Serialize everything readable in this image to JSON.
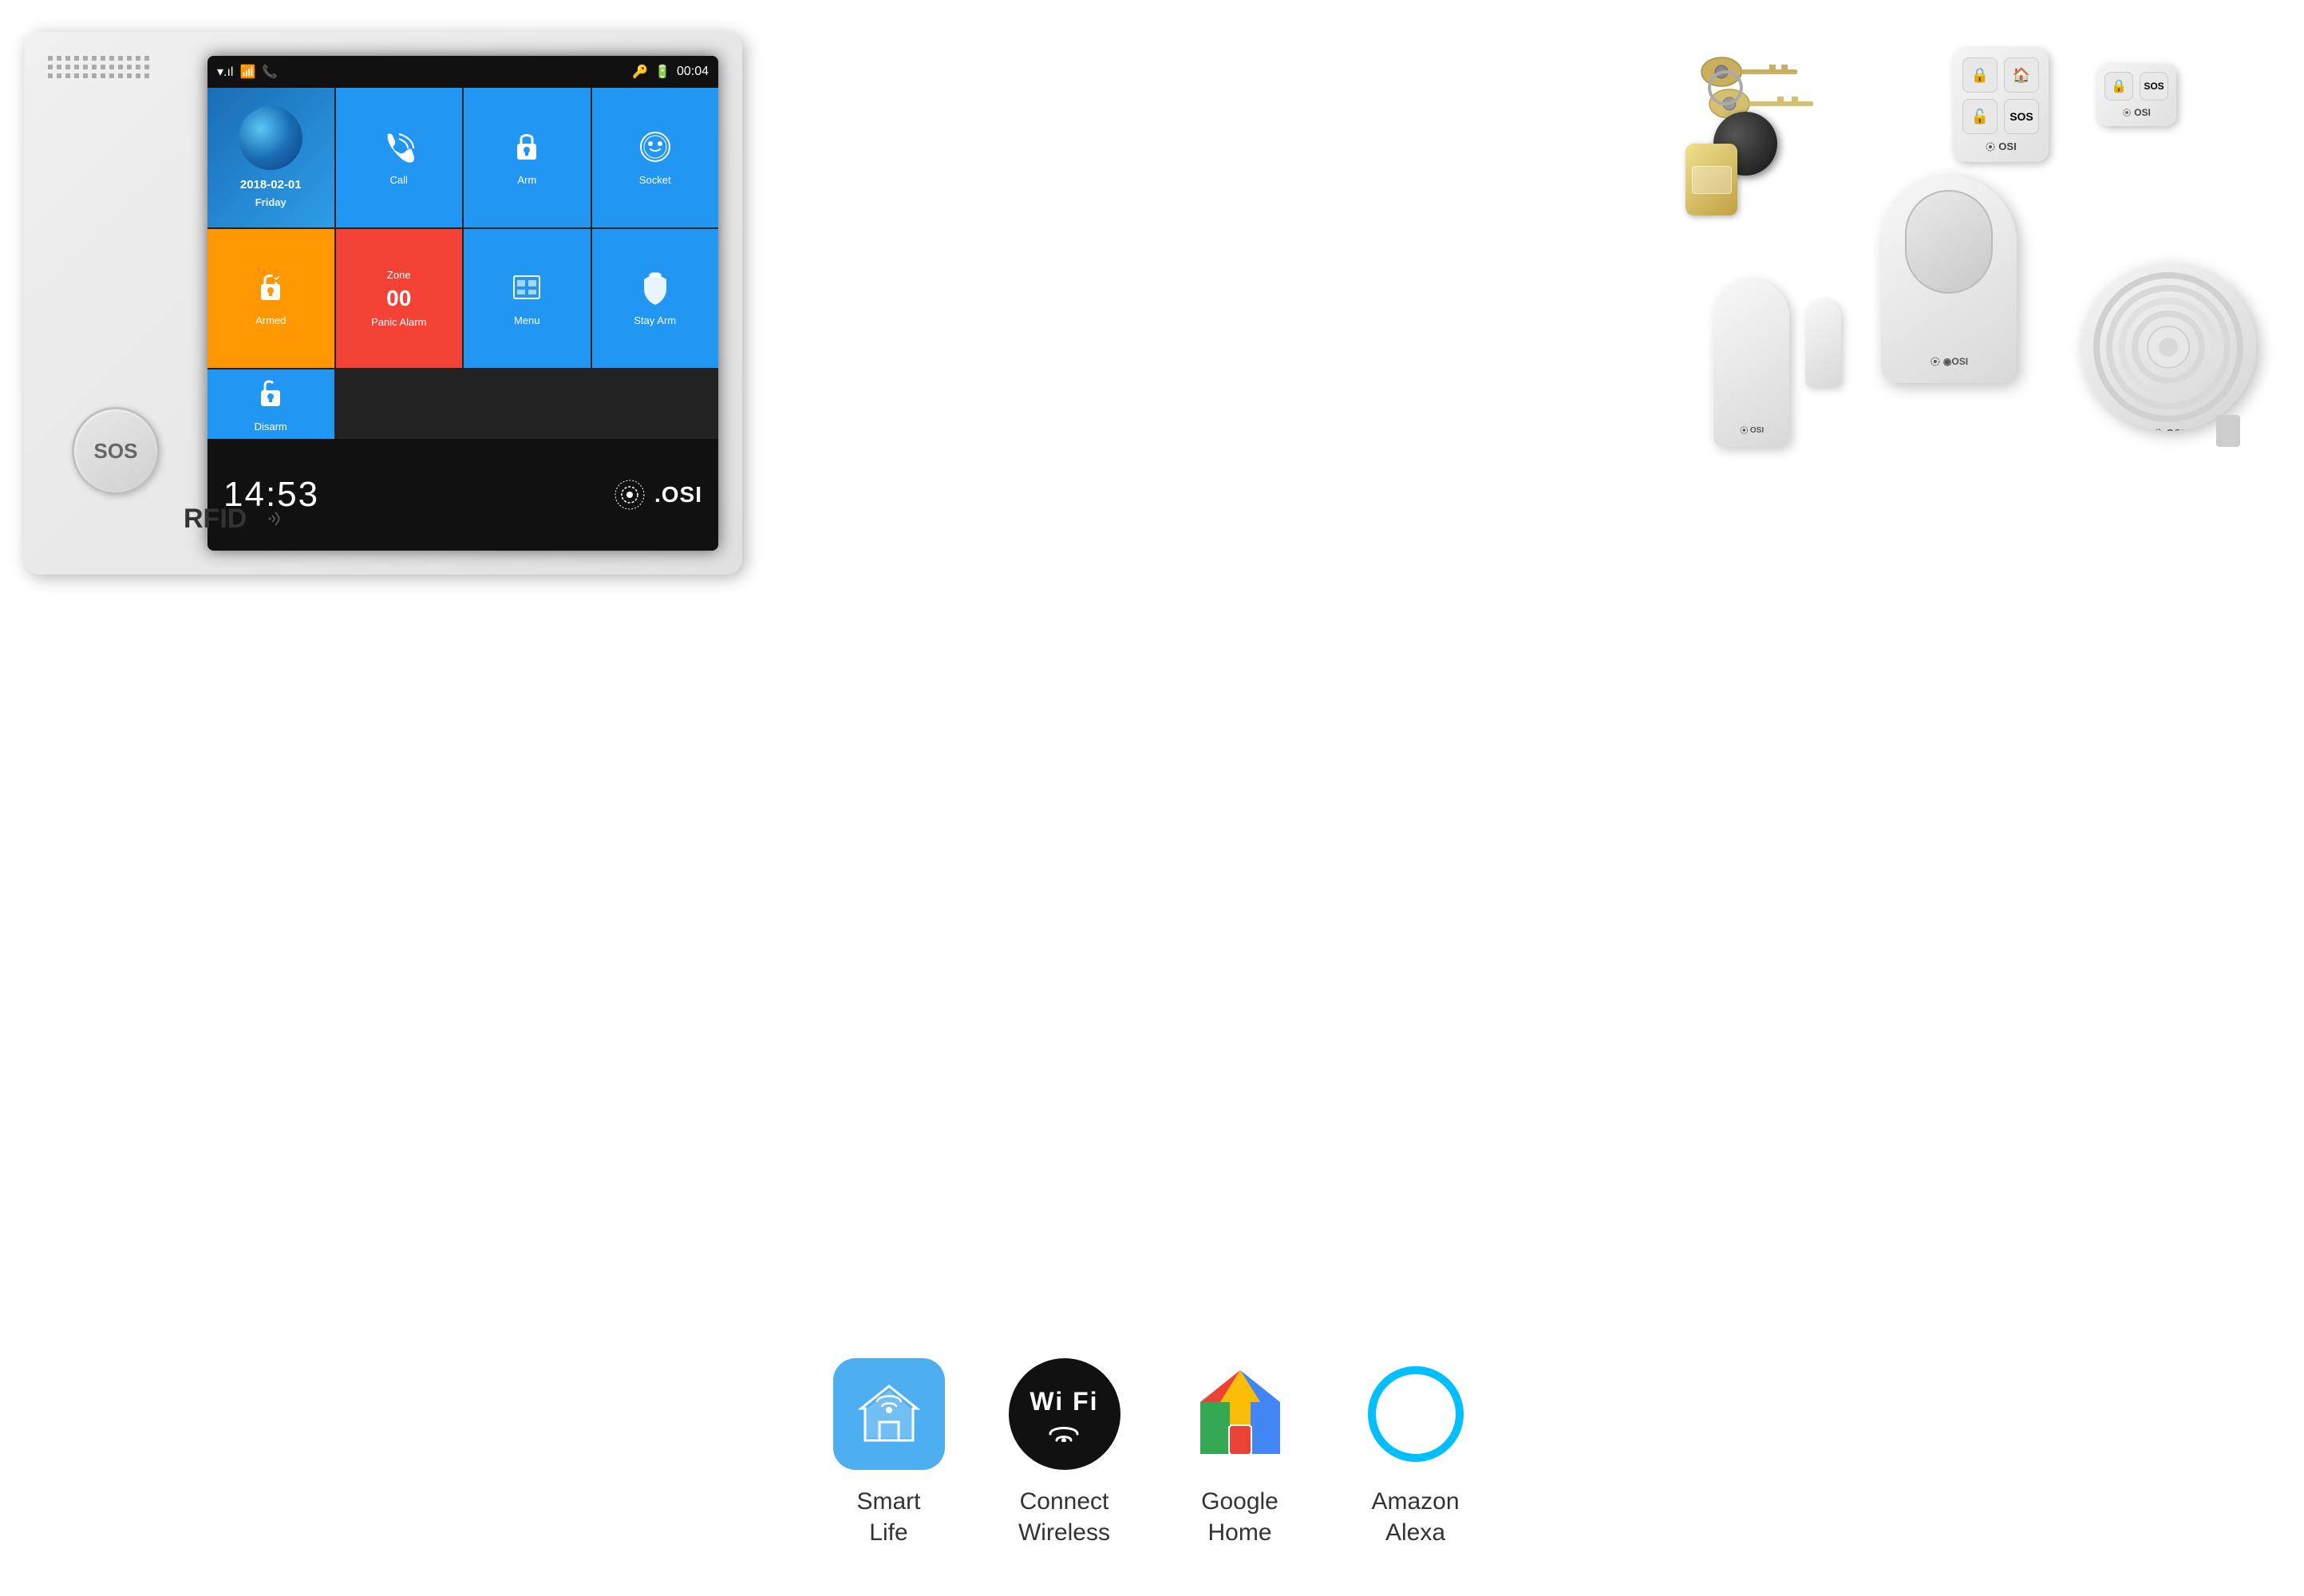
{
  "page": {
    "background": "#ffffff"
  },
  "alarm_panel": {
    "sos_label": "SOS",
    "rfid_label": "RFID",
    "screen": {
      "date": "2018-02-01",
      "day": "Friday",
      "time": "14:53",
      "status_time": "00:04",
      "cells": [
        {
          "id": "date-cell",
          "label": "Friday",
          "sublabel": "2018-02-01"
        },
        {
          "id": "call",
          "label": "Call",
          "icon": "📞"
        },
        {
          "id": "arm",
          "label": "Arm",
          "icon": "🔒"
        },
        {
          "id": "socket",
          "label": "Socket",
          "icon": "🔌"
        },
        {
          "id": "armed",
          "label": "Armed",
          "icon": "🔐"
        },
        {
          "id": "panic",
          "label": "Panic Alarm",
          "zone_label": "Zone",
          "zone_number": "00"
        },
        {
          "id": "menu",
          "label": "Menu",
          "icon": "📋"
        },
        {
          "id": "stay-arm",
          "label": "Stay Arm",
          "icon": "🏠"
        },
        {
          "id": "disarm",
          "label": "Disarm",
          "icon": "🔓"
        }
      ],
      "osi_brand": ".OSI"
    }
  },
  "features": [
    {
      "id": "smart-life",
      "icon_type": "smart-life",
      "label": "Smart\nLife",
      "label_line1": "Smart",
      "label_line2": "Life"
    },
    {
      "id": "wifi",
      "icon_type": "wifi",
      "icon_text": "Wi Fi",
      "label": "Connect\nWireless",
      "label_line1": "Connect",
      "label_line2": "Wireless"
    },
    {
      "id": "google-home",
      "icon_type": "google-home",
      "label": "Google\nHome",
      "label_line1": "Google",
      "label_line2": "Home"
    },
    {
      "id": "alexa",
      "icon_type": "alexa",
      "label": "Amazon\nAlexa",
      "label_line1": "Amazon",
      "label_line2": "Alexa"
    }
  ],
  "components": {
    "pir_sensor": {
      "brand": "◉OSI"
    },
    "door_sensor": {
      "brand": "◉OSI"
    },
    "siren": {
      "brand": "◉OSI"
    },
    "remote1": {
      "brand": "◁OSI",
      "buttons": [
        "🔒",
        "🏠",
        "🔓",
        "SOS"
      ]
    },
    "remote2": {
      "brand": "◁OSI",
      "buttons": [
        "🔒",
        "SOS"
      ]
    }
  }
}
